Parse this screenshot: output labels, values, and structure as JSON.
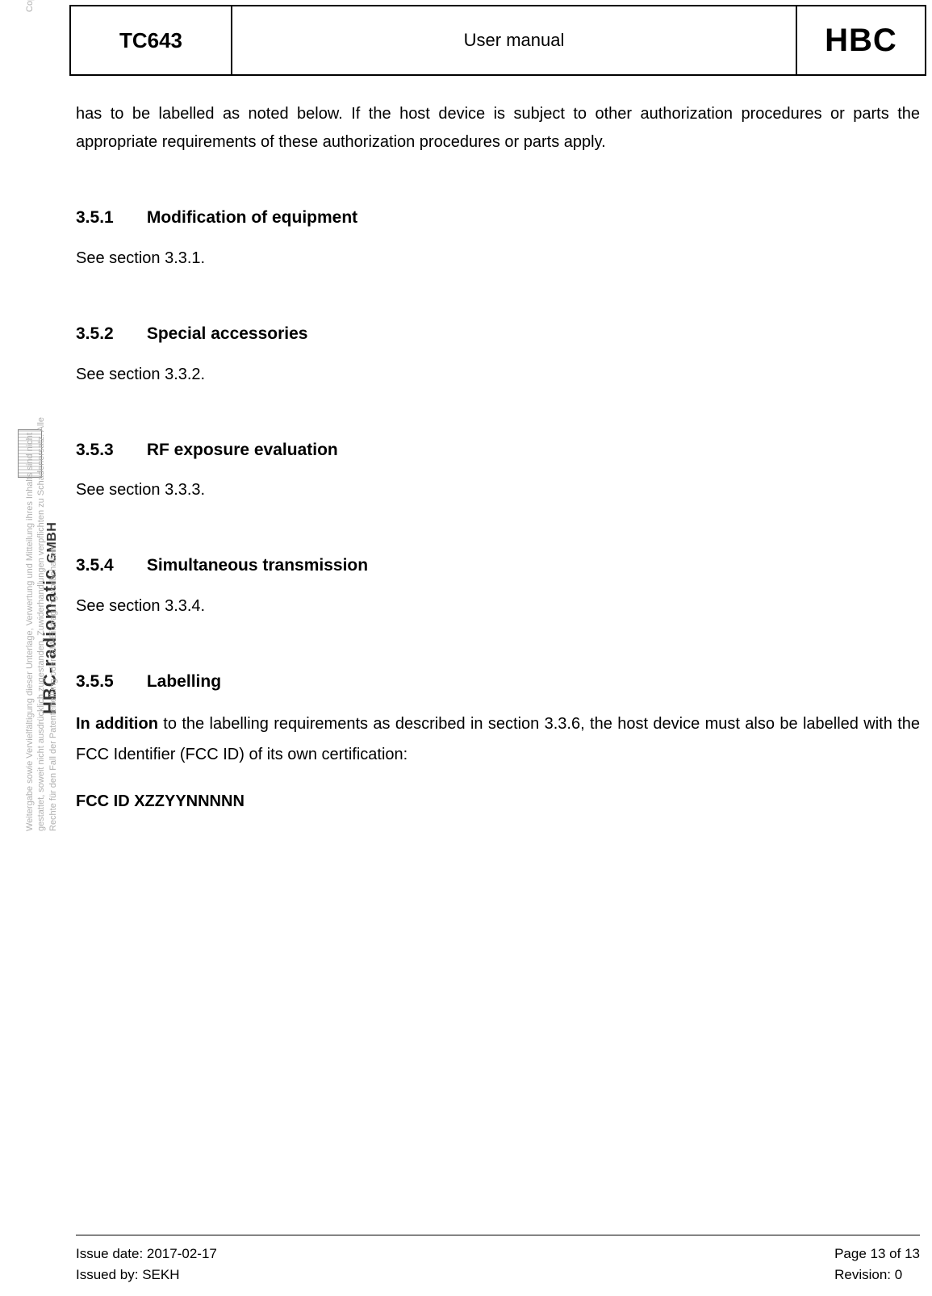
{
  "sidebar": {
    "copyright_en": "Copying of this document, and giving it to others and the use or communication of the contents thereof, are forbidden without express authority. Offenders are liable to the payment of damages. All rights are reserved in the event of the grant of patent or the registration of a utility model or design.",
    "company": "HBC-radiomatic",
    "company_suffix": "GMBH",
    "copyright_de": "Weitergabe sowie Vervielfältigung dieser Unterlage, Verwertung und Mitteilung ihres Inhalts sind nicht gestattet, soweit nicht ausdrücklich zugestanden. Zuwiderhandlungen verpflichten zu Schadenersatz. Alle Rechte für den Fall der Patenterteilung oder GM-Eintragung vorbehalten."
  },
  "header": {
    "doc_code": "TC643",
    "title": "User manual",
    "brand": "HBC"
  },
  "intro": "has to be labelled as noted below. If the host device is subject to other authorization procedures or parts the appropriate requirements of these authorization procedures or parts apply.",
  "sections": [
    {
      "num": "3.5.1",
      "title": "Modification of equipment",
      "body": "See section 3.3.1."
    },
    {
      "num": "3.5.2",
      "title": "Special accessories",
      "body": "See section 3.3.2."
    },
    {
      "num": "3.5.3",
      "title": "RF exposure evaluation",
      "body": "See section 3.3.3."
    },
    {
      "num": "3.5.4",
      "title": "Simultaneous transmission",
      "body": "See section 3.3.4."
    }
  ],
  "labelling": {
    "num": "3.5.5",
    "title": "Labelling",
    "lead_bold": "In addition",
    "body_rest": " to the labelling requirements as described in section 3.3.6, the host device must also be labelled with the FCC Identifier (FCC ID) of its own certification:",
    "fccid": "FCC ID XZZYYNNNNN"
  },
  "footer": {
    "issue_date_label": "Issue date: ",
    "issue_date": "2017-02-17",
    "issued_by_label": "Issued by: ",
    "issued_by": "SEKH",
    "page_label": "Page ",
    "page_current": "13",
    "page_of": " of ",
    "page_total": "13",
    "revision_label": "Revision: ",
    "revision": "0"
  }
}
